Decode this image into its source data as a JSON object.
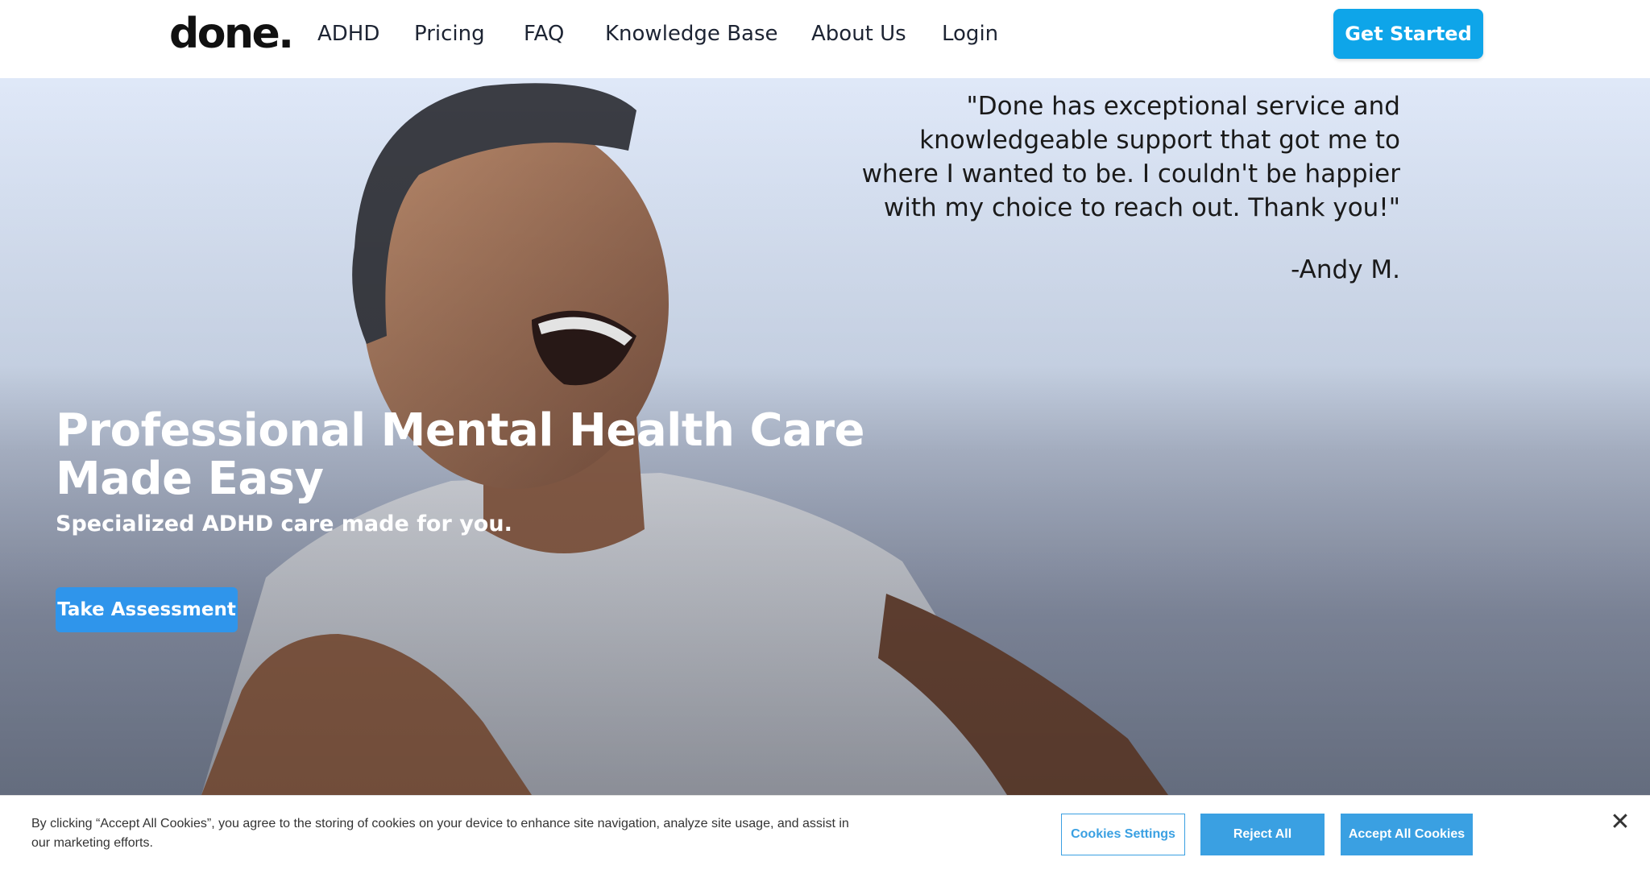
{
  "header": {
    "logo": "done.",
    "nav": {
      "adhd": "ADHD",
      "pricing": "Pricing",
      "faq": "FAQ",
      "knowledge_base": "Knowledge Base",
      "about_us": "About Us",
      "login": "Login"
    },
    "cta": "Get Started"
  },
  "hero": {
    "quote": "\"Done has exceptional service and knowledgeable support that got me to where I wanted to be. I couldn't be happier with my choice to reach out. Thank you!\"",
    "quote_author": "-Andy M.",
    "title": "Professional Mental Health Care Made Easy",
    "subtitle": "Specialized ADHD care made for you.",
    "button": "Take Assessment"
  },
  "cookie_banner": {
    "text": "By clicking “Accept All Cookies”, you agree to the storing of cookies on your device to enhance site navigation, analyze site usage, and assist in our marketing efforts.",
    "settings_button": "Cookies Settings",
    "reject_button": "Reject All",
    "accept_button": "Accept All Cookies",
    "close_icon": "close-icon"
  },
  "colors": {
    "brand_blue": "#0ea5e9",
    "assessment_blue": "#2f95eb",
    "cookie_blue": "#3aa0e2",
    "text_dark": "#1d2433"
  }
}
